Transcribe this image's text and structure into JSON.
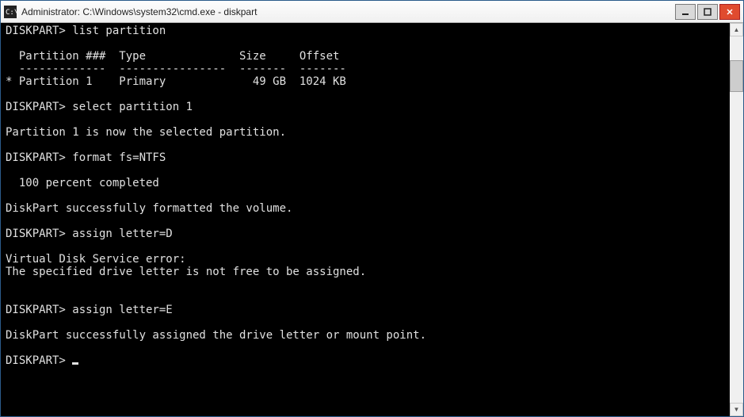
{
  "titlebar": {
    "title": "Administrator: C:\\Windows\\system32\\cmd.exe - diskpart"
  },
  "windowControls": {
    "minimize": "minimize-button",
    "maximize": "maximize-button",
    "close": "close-button"
  },
  "prompt": "DISKPART>",
  "terminal": {
    "lines": [
      "DISKPART> list partition",
      "",
      "  Partition ###  Type              Size     Offset",
      "  -------------  ----------------  -------  -------",
      "* Partition 1    Primary             49 GB  1024 KB",
      "",
      "DISKPART> select partition 1",
      "",
      "Partition 1 is now the selected partition.",
      "",
      "DISKPART> format fs=NTFS",
      "",
      "  100 percent completed",
      "",
      "DiskPart successfully formatted the volume.",
      "",
      "DISKPART> assign letter=D",
      "",
      "Virtual Disk Service error:",
      "The specified drive letter is not free to be assigned.",
      "",
      "",
      "DISKPART> assign letter=E",
      "",
      "DiskPart successfully assigned the drive letter or mount point.",
      ""
    ],
    "finalPrompt": "DISKPART> "
  },
  "scrollbar": {
    "thumbTop": 30,
    "thumbHeight": 40
  }
}
